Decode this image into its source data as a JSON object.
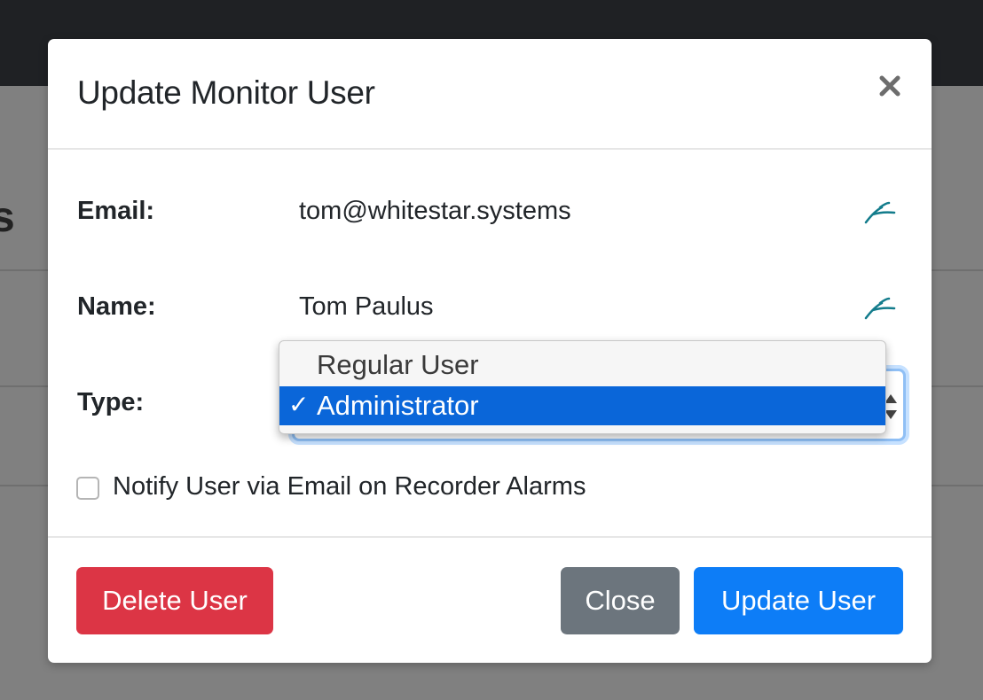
{
  "modal": {
    "title": "Update Monitor User",
    "close_icon": "close-icon"
  },
  "fields": {
    "email": {
      "label": "Email:",
      "value": "tom@whitestar.systems",
      "edit_icon": "edit-pen-icon"
    },
    "name": {
      "label": "Name:",
      "value": "Tom Paulus",
      "edit_icon": "edit-pen-icon"
    },
    "type": {
      "label": "Type:",
      "options": [
        {
          "label": "Regular User",
          "selected": false
        },
        {
          "label": "Administrator",
          "selected": true
        }
      ],
      "selected_mark": "✓"
    }
  },
  "notify": {
    "label": "Notify User via Email on Recorder Alarms",
    "checked": false
  },
  "buttons": {
    "delete": "Delete User",
    "close": "Close",
    "update": "Update User"
  },
  "colors": {
    "danger": "#dc3545",
    "secondary": "#6c757d",
    "primary": "#0d7df7",
    "option_highlight": "#0a66d9",
    "edit_icon": "#137c8c"
  }
}
